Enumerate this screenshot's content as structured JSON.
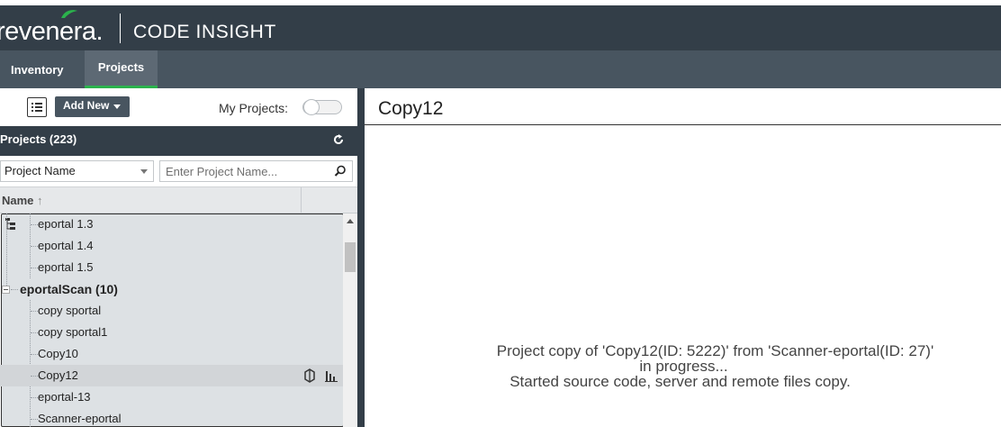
{
  "brand": {
    "logo_text": "revenera.",
    "divider": "|",
    "product": "CODE INSIGHT"
  },
  "nav": {
    "tabs": [
      {
        "label": "Inventory",
        "active": false
      },
      {
        "label": "Projects",
        "active": true
      }
    ]
  },
  "toolbar": {
    "add_new_label": "Add New",
    "my_projects_label": "My Projects:",
    "my_projects_toggle": "off"
  },
  "projects_panel": {
    "header": "Projects (223)",
    "filter_select_value": "Project Name",
    "search_placeholder": "Enter Project Name...",
    "column_name": "Name",
    "sort_indicator": "↑"
  },
  "tree": {
    "rows": [
      {
        "label": "eportal 1.3",
        "type": "leaf"
      },
      {
        "label": "eportal 1.4",
        "type": "leaf"
      },
      {
        "label": "eportal 1.5",
        "type": "leaf"
      },
      {
        "label": "eportalScan (10)",
        "type": "group",
        "expanded": true
      },
      {
        "label": "copy sportal",
        "type": "leaf"
      },
      {
        "label": "copy sportal1",
        "type": "leaf"
      },
      {
        "label": "Copy10",
        "type": "leaf"
      },
      {
        "label": "Copy12",
        "type": "leaf",
        "selected": true
      },
      {
        "label": "eportal-13",
        "type": "leaf"
      },
      {
        "label": "Scanner-eportal",
        "type": "leaf"
      }
    ]
  },
  "detail": {
    "title": "Copy12",
    "message_line1": "Project copy of 'Copy12(ID: 5222)' from 'Scanner-eportal(ID: 27)'",
    "message_line2": "in progress...",
    "message_line3": "Started source code, server and remote files copy."
  },
  "colors": {
    "header_bg": "#333e48",
    "nav_bg": "#485560",
    "active_tab_accent": "#2bb24c",
    "selected_row": "#d2d5d8"
  }
}
